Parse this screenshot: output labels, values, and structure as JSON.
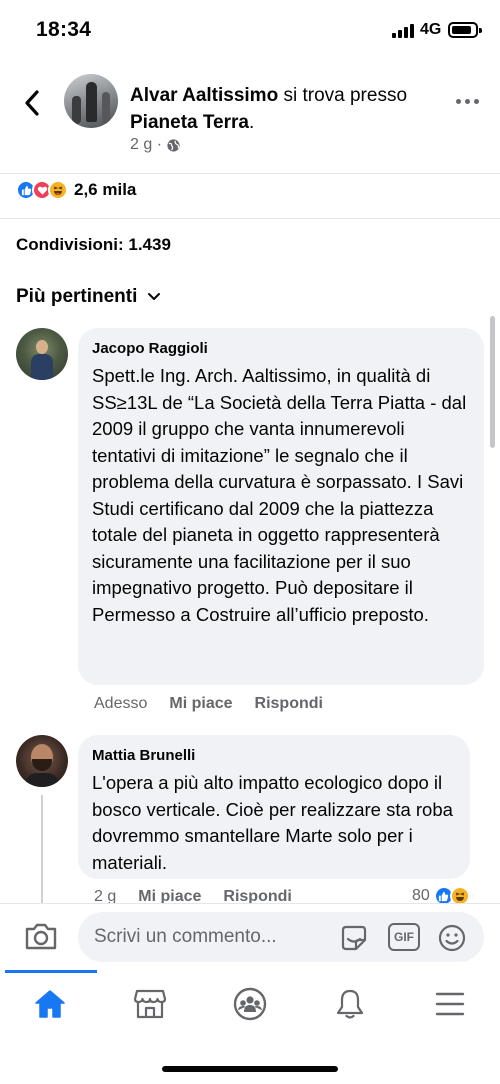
{
  "status_bar": {
    "time": "18:34",
    "network": "4G"
  },
  "post_header": {
    "author": "Alvar Aaltissimo",
    "connector": " si trova presso ",
    "place": "Pianeta Terra",
    "place_suffix": ".",
    "age": "2 g ·",
    "privacy_icon": "globe-icon"
  },
  "reactions": {
    "icons": [
      "like",
      "love",
      "haha"
    ],
    "count": "2,6 mila"
  },
  "shares": {
    "label": "Condivisioni: 1.439"
  },
  "sort": {
    "label": "Più pertinenti"
  },
  "comments": [
    {
      "author": "Jacopo Raggioli",
      "text": "Spett.le Ing. Arch. Aaltissimo, in qualità di SS≥13L de “La Società della Terra Piatta - dal 2009 il gruppo che vanta innumerevoli tentativi di imitazione” le segnalo che il problema della curvatura è sorpassato. I Savi Studi certificano dal 2009 che la piattezza totale del pianeta in oggetto rappresenterà sicuramente una facilitazione per il suo impegnativo progetto. Può depositare il Permesso a Costruire all’ufficio preposto.",
      "time": "Adesso",
      "like_label": "Mi piace",
      "reply_label": "Rispondi"
    },
    {
      "author": "Mattia Brunelli",
      "text": "L'opera a più alto impatto ecologico dopo il bosco verticale. Cioè per realizzare sta roba dovremmo smantellare Marte solo per i materiali.",
      "time": "2 g",
      "like_label": "Mi piace",
      "reply_label": "Rispondi",
      "reaction_count": "80"
    }
  ],
  "composer": {
    "placeholder": "Scrivi un commento...",
    "gif_label": "GIF"
  },
  "tabbar": {
    "items": [
      "home-icon",
      "marketplace-icon",
      "groups-icon",
      "notifications-icon",
      "menu-icon"
    ],
    "active": "home-icon"
  },
  "colors": {
    "accent": "#1877f2",
    "secondary_text": "#65676b",
    "bubble": "#f0f2f5",
    "love": "#f33e58",
    "haha": "#f7b125"
  }
}
